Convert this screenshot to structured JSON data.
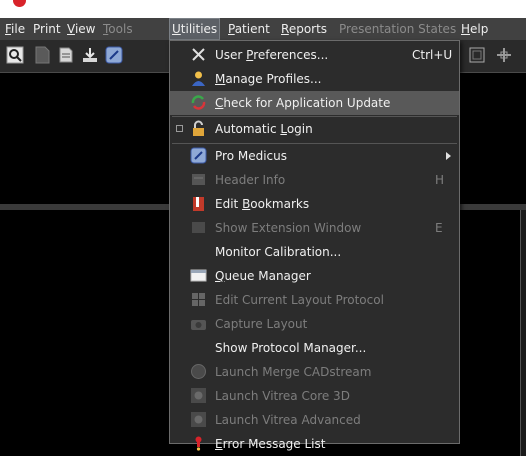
{
  "menubar": {
    "items": [
      {
        "label": "File",
        "ul": "F",
        "rest": "ile",
        "state": "normal"
      },
      {
        "label": "Print",
        "ul": "",
        "rest": "Print",
        "state": "normal"
      },
      {
        "label": "View",
        "ul": "V",
        "rest": "iew",
        "state": "normal"
      },
      {
        "label": "Tools",
        "ul": "T",
        "rest": "ools",
        "state": "disabled"
      },
      {
        "label": "Utilities",
        "ul": "U",
        "rest": "tilities",
        "state": "active"
      },
      {
        "label": "Patient",
        "ul": "P",
        "rest": "atient",
        "state": "normal"
      },
      {
        "label": "Reports",
        "ul": "R",
        "rest": "eports",
        "state": "normal"
      },
      {
        "label": "Presentation States",
        "ul": "",
        "rest": "Presentation States",
        "state": "disabled"
      },
      {
        "label": "Help",
        "ul": "H",
        "rest": "elp",
        "state": "normal"
      }
    ]
  },
  "utilities_menu": {
    "user_preferences": {
      "pre": "User ",
      "ul": "P",
      "post": "references...",
      "shortcut": "Ctrl+U"
    },
    "manage_profiles": {
      "pre": "",
      "ul": "M",
      "post": "anage Profiles..."
    },
    "check_update": {
      "pre": "",
      "ul": "C",
      "post": "heck for Application Update"
    },
    "automatic_login": {
      "pre": "Automatic ",
      "ul": "L",
      "post": "ogin"
    },
    "pro_medicus": {
      "label": "Pro Medicus"
    },
    "header_info": {
      "label": "Header Info",
      "shortcut": "H"
    },
    "edit_bookmarks": {
      "pre": "Edit ",
      "ul": "B",
      "post": "ookmarks"
    },
    "show_extension": {
      "label": "Show Extension Window",
      "shortcut": "E"
    },
    "monitor_calibration": {
      "label": "Monitor Calibration..."
    },
    "queue_manager": {
      "pre": "",
      "ul": "Q",
      "post": "ueue Manager"
    },
    "edit_layout_protocol": {
      "label": "Edit Current Layout Protocol"
    },
    "capture_layout": {
      "label": "Capture Layout"
    },
    "show_protocol_manager": {
      "label": "Show Protocol Manager..."
    },
    "launch_merge": {
      "label": "Launch Merge CADstream"
    },
    "launch_core3d": {
      "label": "Launch Vitrea Core 3D"
    },
    "launch_advanced": {
      "label": "Launch Vitrea Advanced"
    },
    "error_message_list": {
      "pre": "",
      "ul": "E",
      "post": "rror Message List"
    }
  },
  "colors": {
    "menubar_bg": "#414141",
    "menu_bg": "#2c2c2c",
    "highlight": "#595959",
    "disabled_text": "#7d7d7d",
    "app_red": "#d8232a"
  }
}
